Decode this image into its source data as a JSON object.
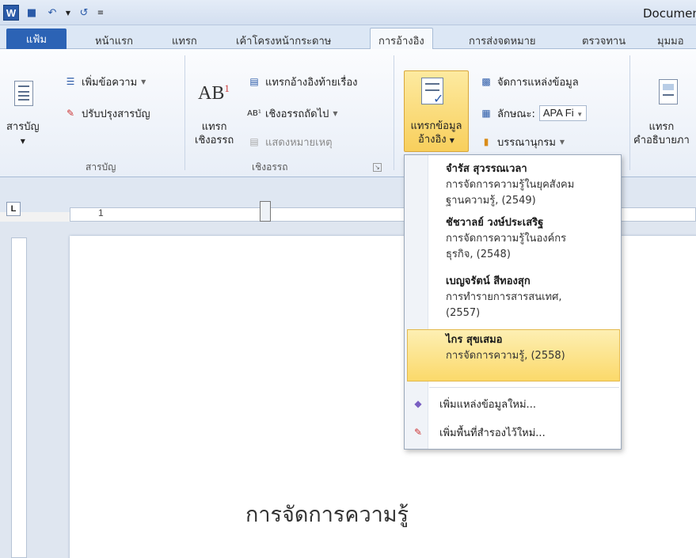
{
  "titlebar": {
    "doc_title": "Document"
  },
  "tabs": {
    "file": "แฟ้ม",
    "home": "หน้าแรก",
    "insert": "แทรก",
    "page_layout": "เค้าโครงหน้ากระดาษ",
    "references": "การอ้างอิง",
    "mailings": "การส่งจดหมาย",
    "review": "ตรวจทาน",
    "view": "มุมมอ"
  },
  "ribbon": {
    "toc_group": {
      "toc_label": "สารบัญ",
      "add_text": "เพิ่มข้อความ",
      "update_table": "ปรับปรุงสารบัญ",
      "group_label": "สารบัญ"
    },
    "footnotes_group": {
      "insert_footnote_line1": "แทรก",
      "insert_footnote_line2": "เชิงอรรถ",
      "insert_endnote": "แทรกอ้างอิงท้ายเรื่อง",
      "next_footnote": "เชิงอรรถถัดไป",
      "show_notes": "แสดงหมายเหตุ",
      "group_label": "เชิงอรรถ"
    },
    "citations_group": {
      "insert_citation_line1": "แทรกข้อมูล",
      "insert_citation_line2": "อ้างอิง",
      "manage_sources": "จัดการแหล่งข้อมูล",
      "style_label": "ลักษณะ:",
      "style_value": "APA Fi",
      "bibliography": "บรรณานุกรม"
    },
    "captions_group": {
      "insert_caption_line1": "แทรก",
      "insert_caption_line2": "คำอธิบายภา"
    }
  },
  "ruler": {
    "number": "1"
  },
  "dropdown": {
    "sources": [
      {
        "author": "จำรัส สุวรรณเวลา",
        "title_line1": "การจัดการความรู้ในยุคสังคม",
        "title_line2": "ฐานความรู้, (2549)"
      },
      {
        "author": "ชัชวาลย์ วงษ์ประเสริฐ",
        "title_line1": "การจัดการความรู้ในองค์กร",
        "title_line2": "ธุรกิจ, (2548)"
      },
      {
        "author": "เบญจรัตน์ สีทองสุก",
        "title_line1": "การทำรายการสารสนเทศ,",
        "title_line2": "(2557)"
      },
      {
        "author": "ไกร สุขเสมอ",
        "title_line1": "การจัดการความรู้, (2558)",
        "title_line2": ""
      }
    ],
    "add_source": "เพิ่มแหล่งข้อมูลใหม่...",
    "add_placeholder": "เพิ่มพื้นที่สำรองไว้ใหม่..."
  },
  "document": {
    "text": "การจัดการความรู้"
  },
  "colors": {
    "file_tab": "#2c63b5",
    "highlight": "#fbd96a",
    "ribbon_bg": "#fbfcfe"
  }
}
